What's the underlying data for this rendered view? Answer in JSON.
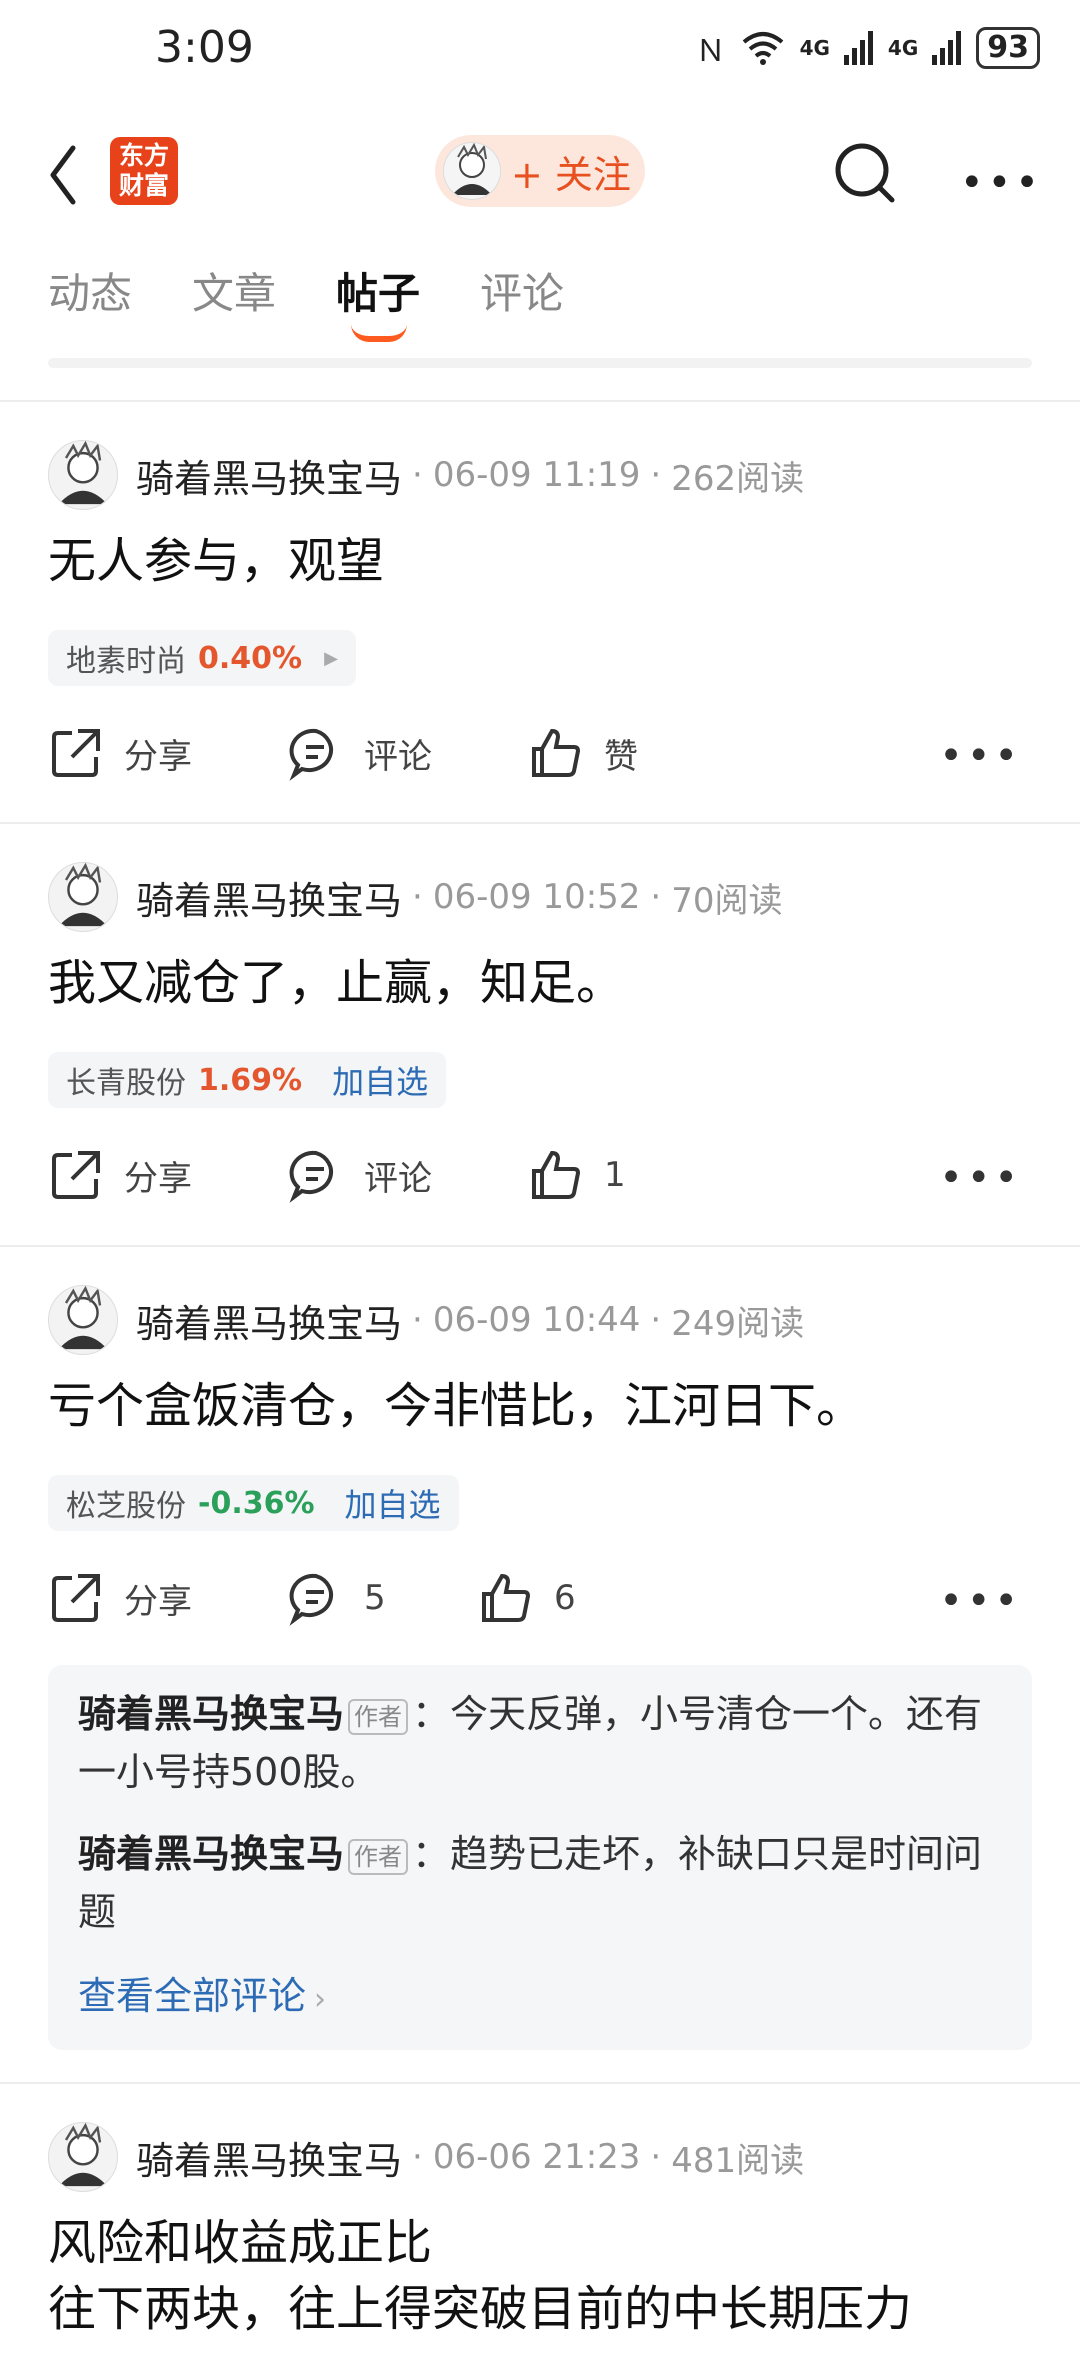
{
  "status_bar": {
    "time": "3:09",
    "battery": "93",
    "signal1": "4G",
    "signal2": "4G"
  },
  "header": {
    "logo_line1": "东方",
    "logo_line2": "财富",
    "follow_label": "+ 关注"
  },
  "tabs": [
    {
      "label": "动态"
    },
    {
      "label": "文章"
    },
    {
      "label": "帖子",
      "active": true
    },
    {
      "label": "评论"
    }
  ],
  "posts": [
    {
      "author": "骑着黑马换宝马",
      "date": "06-09 11:19",
      "reads": "262阅读",
      "content": "无人参与，观望",
      "stock": {
        "name": "地素时尚",
        "pct": "0.40%",
        "color": "#e4572e",
        "add": ""
      },
      "actions": {
        "share": "分享",
        "comment": "评论",
        "like": "赞"
      }
    },
    {
      "author": "骑着黑马换宝马",
      "date": "06-09 10:52",
      "reads": "70阅读",
      "content": "我又减仓了，止赢，知足。",
      "stock": {
        "name": "长青股份",
        "pct": "1.69%",
        "color": "#e4572e",
        "add": "加自选"
      },
      "actions": {
        "share": "分享",
        "comment": "评论",
        "like": "1"
      }
    },
    {
      "author": "骑着黑马换宝马",
      "date": "06-09 10:44",
      "reads": "249阅读",
      "content": "亏个盒饭清仓，今非惜比，江河日下。",
      "stock": {
        "name": "松芝股份",
        "pct": "-0.36%",
        "color": "#2aa05a",
        "add": "加自选"
      },
      "actions": {
        "share": "分享",
        "comment": "5",
        "like": "6"
      },
      "comments": [
        {
          "user": "骑着黑马换宝马",
          "tag": "作者",
          "text": "：今天反弹，小号清仓一个。还有一小号持500股。"
        },
        {
          "user": "骑着黑马换宝马",
          "tag": "作者",
          "text": "：趋势已走坏，补缺口只是时间问题"
        }
      ],
      "view_all": "查看全部评论"
    },
    {
      "author": "骑着黑马换宝马",
      "date": "06-06 21:23",
      "reads": "481阅读",
      "content_line1": "风险和收益成正比",
      "content_line2": "往下两块，往上得突破目前的中长期压力"
    }
  ]
}
